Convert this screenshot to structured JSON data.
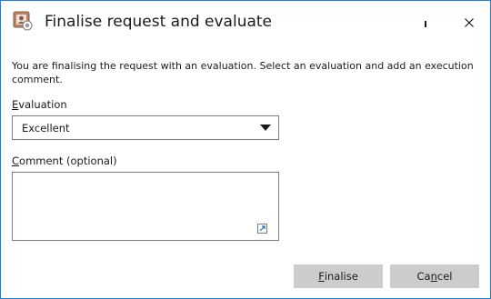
{
  "window": {
    "title": "Finalise request and evaluate",
    "icon": "request-evaluation-icon",
    "border_color": "#1883d7"
  },
  "dialog": {
    "message": "You are finalising the request with an evaluation. Select an evaluation and add an execution comment.",
    "evaluation_label_mnemonic": "E",
    "evaluation_label_rest": "valuation",
    "evaluation_value": "Excellent",
    "comment_label_mnemonic": "C",
    "comment_label_rest": "omment (optional)",
    "comment_value": ""
  },
  "buttons": {
    "finalise_mnemonic": "F",
    "finalise_rest": "inalise",
    "cancel_pre": "Ca",
    "cancel_mnemonic": "n",
    "cancel_rest": "cel",
    "background": "#cccccc"
  }
}
